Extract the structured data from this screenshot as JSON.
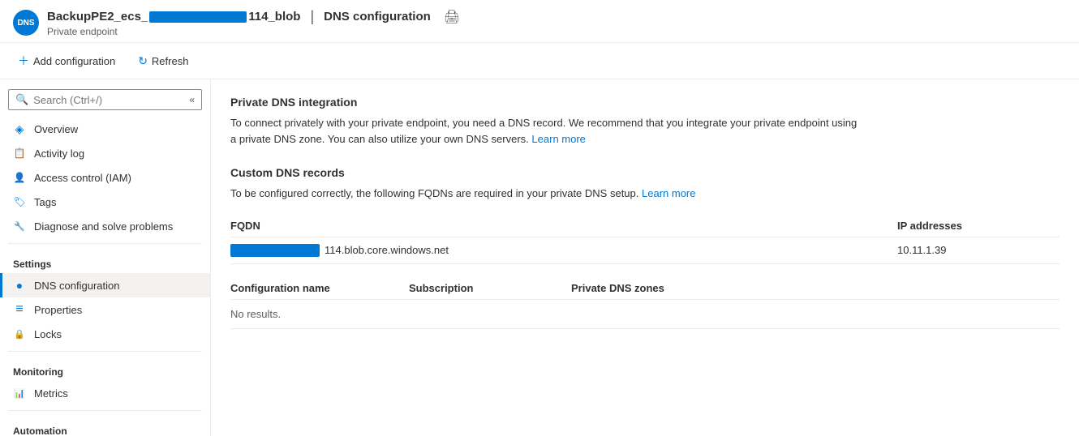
{
  "header": {
    "avatar_text": "DNS",
    "resource_name_part1": "BackupPE2_ecs_",
    "resource_name_redacted": true,
    "resource_name_part2": "114_blob",
    "page_title": "DNS configuration",
    "subtitle": "Private endpoint",
    "print_tooltip": "Print"
  },
  "toolbar": {
    "add_configuration_label": "Add configuration",
    "refresh_label": "Refresh"
  },
  "search": {
    "placeholder": "Search (Ctrl+/)"
  },
  "sidebar": {
    "nav_items": [
      {
        "id": "overview",
        "label": "Overview",
        "icon": "◈"
      },
      {
        "id": "activity-log",
        "label": "Activity log",
        "icon": "📋"
      },
      {
        "id": "access-control",
        "label": "Access control (IAM)",
        "icon": "👤"
      },
      {
        "id": "tags",
        "label": "Tags",
        "icon": "🏷"
      },
      {
        "id": "diagnose",
        "label": "Diagnose and solve problems",
        "icon": "🔧"
      }
    ],
    "settings_header": "Settings",
    "settings_items": [
      {
        "id": "dns-configuration",
        "label": "DNS configuration",
        "icon": "●",
        "active": true
      },
      {
        "id": "properties",
        "label": "Properties",
        "icon": "≡"
      },
      {
        "id": "locks",
        "label": "Locks",
        "icon": "🔒"
      }
    ],
    "monitoring_header": "Monitoring",
    "monitoring_items": [
      {
        "id": "metrics",
        "label": "Metrics",
        "icon": "📊"
      }
    ],
    "automation_header": "Automation"
  },
  "content": {
    "private_dns_title": "Private DNS integration",
    "private_dns_desc": "To connect privately with your private endpoint, you need a DNS record. We recommend that you integrate your private endpoint using a private DNS zone. You can also utilize your own DNS servers.",
    "private_dns_learn_more": "Learn more",
    "custom_dns_title": "Custom DNS records",
    "custom_dns_desc": "To be configured correctly, the following FQDNs are required in your private DNS setup.",
    "custom_dns_learn_more": "Learn more",
    "fqdn_col": "FQDN",
    "ip_col": "IP addresses",
    "fqdn_value_suffix": "114.blob.core.windows.net",
    "ip_value": "10.11.1.39",
    "config_name_col": "Configuration name",
    "subscription_col": "Subscription",
    "private_dns_zones_col": "Private DNS zones",
    "no_results": "No results."
  }
}
